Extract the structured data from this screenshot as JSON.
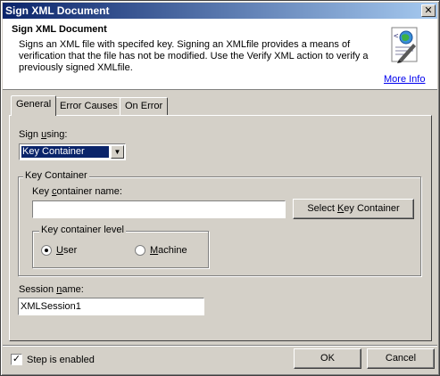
{
  "window": {
    "title": "Sign XML Document",
    "close_glyph": "✕"
  },
  "header": {
    "title": "Sign XML Document",
    "description": "Signs an XML file with specifed key. Signing an XMLfile provides a means of verification that the file has not be modified.  Use the Verify XML action to verify a previously signed XMLfile.",
    "icon": "signed-document-icon",
    "more_info": "More Info"
  },
  "tabs": [
    {
      "label": "General",
      "active": true
    },
    {
      "label": "Error Causes",
      "active": false
    },
    {
      "label": "On Error",
      "active": false
    }
  ],
  "general": {
    "sign_using_label": "Sign using:",
    "sign_using_value": "Key Container",
    "key_container_group": "Key Container",
    "key_container_name_label": "Key container name:",
    "key_container_name_value": "",
    "select_key_container_button": "Select Key Container",
    "key_container_level_group": "Key container level",
    "level_options": [
      {
        "label": "User",
        "selected": true
      },
      {
        "label": "Machine",
        "selected": false
      }
    ],
    "session_name_label": "Session name:",
    "session_name_value": "XMLSession1"
  },
  "footer": {
    "step_enabled_label": "Step is enabled",
    "step_enabled_checked": true,
    "ok_label": "OK",
    "cancel_label": "Cancel"
  }
}
